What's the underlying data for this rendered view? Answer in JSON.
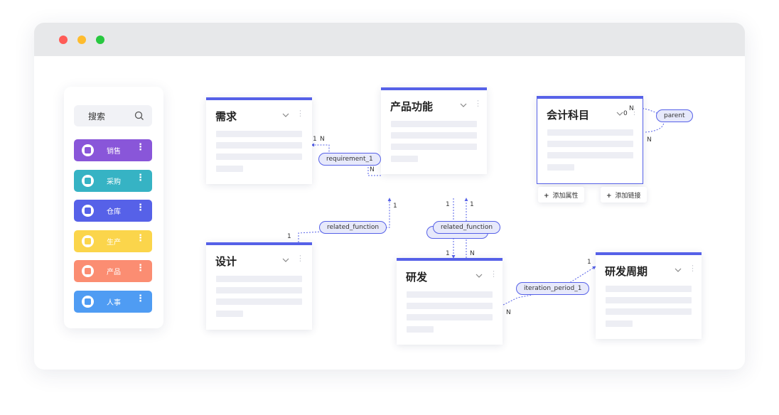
{
  "window": {
    "dots": [
      {
        "name": "close-dot",
        "color": "#ff5c57"
      },
      {
        "name": "minimize-dot",
        "color": "#febc2e"
      },
      {
        "name": "maximize-dot",
        "color": "#28c840"
      }
    ]
  },
  "sidebar": {
    "search_label": "搜索",
    "items": [
      {
        "label": "销售",
        "color": "#8956d9",
        "icon": "sales-icon"
      },
      {
        "label": "采购",
        "color": "#36b3c4",
        "icon": "purchase-icon"
      },
      {
        "label": "仓库",
        "color": "#5661e8",
        "icon": "warehouse-icon"
      },
      {
        "label": "生产",
        "color": "#fbd54b",
        "icon": "production-icon"
      },
      {
        "label": "产品",
        "color": "#fb8d72",
        "icon": "product-icon"
      },
      {
        "label": "人事",
        "color": "#4f9cf3",
        "icon": "hr-icon"
      }
    ],
    "more_glyph": "⋮"
  },
  "entities": {
    "requirement": {
      "title": "需求"
    },
    "product_function": {
      "title": "产品功能"
    },
    "accounting_subject": {
      "title": "会计科目"
    },
    "design": {
      "title": "设计"
    },
    "rnd": {
      "title": "研发"
    },
    "rnd_cycle": {
      "title": "研发周期"
    }
  },
  "card_more_glyph": "⋮",
  "actions": {
    "add_attribute": "添加属性",
    "add_link": "添加链接",
    "plus": "+"
  },
  "relations": {
    "requirement_1": "requirement_1",
    "related_function_design": "related_function",
    "related_function_rnd": "related_function",
    "iteration_period_1": "iteration_period_1",
    "parent": "parent"
  },
  "cardinality": {
    "one": "1",
    "many": "N",
    "zero": "0"
  },
  "colors": {
    "accent": "#5661e8",
    "pill_fill": "#e7e9fb",
    "skeleton": "#edeef4",
    "titlebar": "#e7e8ea"
  }
}
